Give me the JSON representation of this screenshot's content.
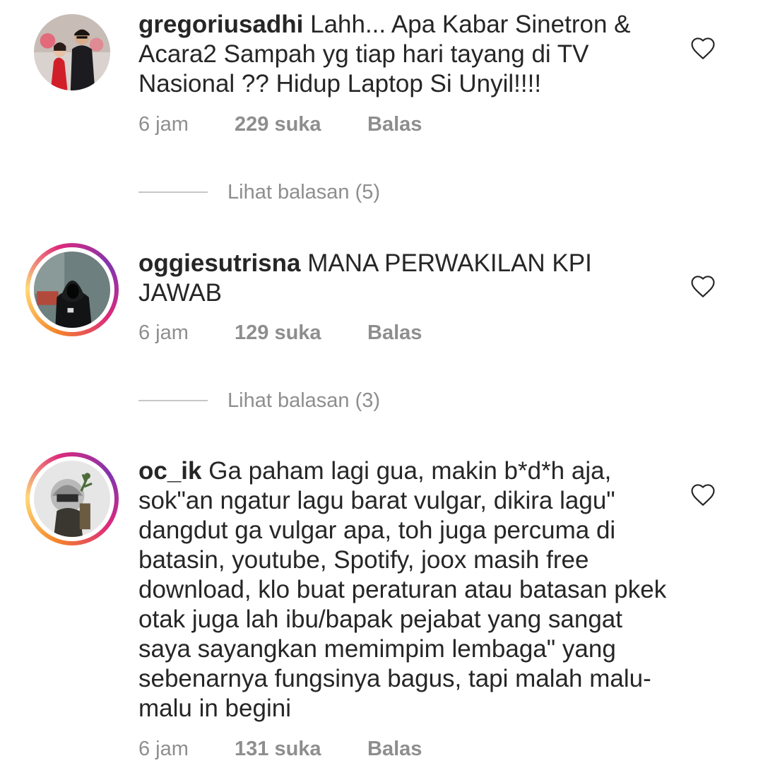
{
  "comments": [
    {
      "username": "gregoriusadhi",
      "text": " Lahh... Apa Kabar Sinetron & Acara2 Sampah yg tiap hari tayang di TV Nasional ?? Hidup Laptop Si Unyil!!!!",
      "time": "6 jam",
      "likes": "229 suka",
      "reply_label": "Balas",
      "view_replies": "Lihat balasan (5)",
      "has_story": false
    },
    {
      "username": "oggiesutrisna",
      "text": " MANA PERWAKILAN KPI JAWAB",
      "time": "6 jam",
      "likes": "129 suka",
      "reply_label": "Balas",
      "view_replies": "Lihat balasan (3)",
      "has_story": true
    },
    {
      "username": "oc_ik",
      "text": " Ga paham lagi gua, makin b*d*h aja, sok\"an ngatur lagu barat vulgar, dikira lagu\" dangdut ga vulgar apa, toh juga percuma di batasin, youtube, Spotify, joox masih free download, klo buat peraturan atau batasan pkek otak juga lah ibu/bapak pejabat yang sangat saya sayangkan memimpim lembaga\" yang sebenarnya fungsinya bagus, tapi malah malu-malu in begini",
      "time": "6 jam",
      "likes": "131 suka",
      "reply_label": "Balas",
      "has_story": true
    }
  ],
  "icons": {
    "like": "heart-outline-icon"
  },
  "colors": {
    "text": "#262626",
    "muted": "#8e8e8e",
    "divider": "#c7c7c7"
  }
}
